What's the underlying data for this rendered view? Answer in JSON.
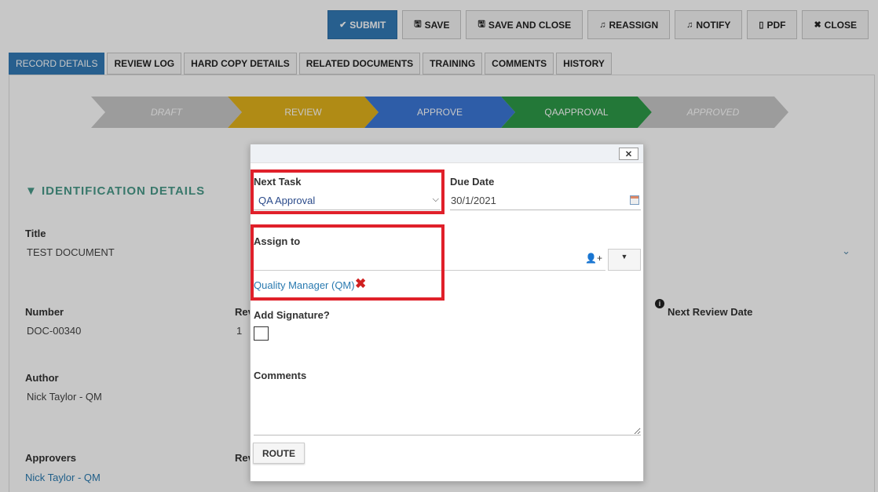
{
  "toolbar": {
    "submit": "SUBMIT",
    "save": "SAVE",
    "save_and_close": "SAVE AND CLOSE",
    "reassign": "REASSIGN",
    "notify": "NOTIFY",
    "pdf": "PDF",
    "close": "CLOSE"
  },
  "tabs": [
    "RECORD DETAILS",
    "REVIEW LOG",
    "HARD COPY DETAILS",
    "RELATED DOCUMENTS",
    "TRAINING",
    "COMMENTS",
    "HISTORY"
  ],
  "workflow": [
    "DRAFT",
    "REVIEW",
    "APPROVE",
    "QAAPPROVAL",
    "APPROVED"
  ],
  "colors": {
    "primary": "#337ab7",
    "draft": "#c8c8c8",
    "review": "#e2b21c",
    "approve": "#3c78d8",
    "qaapproval": "#2e9a48",
    "approved": "#c8c8c8",
    "highlight": "#e0202a",
    "section": "#4a9a8a"
  },
  "identification": {
    "heading": "▼ IDENTIFICATION DETAILS",
    "title_label": "Title",
    "title_value": "TEST DOCUMENT",
    "number_label": "Number",
    "number_value": "DOC-00340",
    "rev_label": "Rev",
    "rev_value": "1",
    "next_review_label": "Next Review Date",
    "author_label": "Author",
    "author_value": "Nick Taylor - QM",
    "approvers_label": "Approvers",
    "approvers_value": "Nick Taylor - QM",
    "rev2_label": "Rev"
  },
  "dialog": {
    "close": "✕",
    "next_task_label": "Next Task",
    "next_task_value": "QA Approval",
    "due_date_label": "Due Date",
    "due_date_value": "30/1/2021",
    "assign_label": "Assign to",
    "assignee": "Quality Manager (QM)",
    "signature_label": "Add Signature?",
    "comments_label": "Comments",
    "route": "ROUTE"
  }
}
